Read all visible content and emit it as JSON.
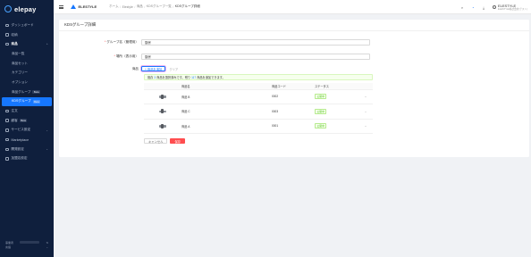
{
  "app": {
    "logo": "elepay"
  },
  "sidebar": {
    "items": [
      {
        "label": "ダッシュボード"
      },
      {
        "label": "収納"
      },
      {
        "label": "商品"
      },
      {
        "label": "商品一覧"
      },
      {
        "label": "商品セット"
      },
      {
        "label": "カテゴリー"
      },
      {
        "label": "オプション"
      },
      {
        "label": "商品グループ",
        "badge": "Beta"
      },
      {
        "label": "KDSグループ",
        "badge": "Beta"
      },
      {
        "label": "注文"
      },
      {
        "label": "顧客",
        "badge": "Beta"
      },
      {
        "label": "サービス設定"
      },
      {
        "label": "Marketplace"
      },
      {
        "label": "開発設定"
      },
      {
        "label": "加盟店設定"
      }
    ],
    "footer": {
      "line1": "事業者",
      "line2": "言語"
    }
  },
  "header": {
    "shop_name": "ELESTYLE",
    "breadcrumbs": [
      "ホーム",
      "Elestyle",
      "商品",
      "KDSグループ一覧",
      "KDSグループ詳細"
    ],
    "user_name": "ELESTYLE",
    "user_sub": "ELESTYLE株式会社(テスト)"
  },
  "page": {
    "title": "KDSグループ詳細",
    "form": {
      "group_name_label": "グループ名（管理用）",
      "group_name_value": "厨房",
      "kitchen_name_label": "場所（表示用）",
      "kitchen_name_value": "厨房",
      "products_label": "商品",
      "add_button": "+ 商品を追加",
      "clear_button": "クリア",
      "alert_prefix": "既存",
      "alert_count_selected": "3",
      "alert_mid": "商品を選択済みです。残り",
      "alert_count_remaining": "117",
      "alert_suffix": "商品を追加できます。"
    },
    "table": {
      "headers": [
        "",
        "商品名",
        "商品コード",
        "ステータス",
        ""
      ],
      "rows": [
        {
          "name": "商品 B",
          "code": "0002",
          "status": "公開中"
        },
        {
          "name": "商品 C",
          "code": "0003",
          "status": "公開中"
        },
        {
          "name": "商品 A",
          "code": "0001",
          "status": "公開中"
        }
      ]
    },
    "buttons": {
      "cancel": "キャンセル",
      "save": "保存"
    }
  },
  "colors": {
    "sidebar_bg": "#0f1f3d",
    "primary": "#1677ff",
    "danger": "#ff4d4f",
    "success": "#52c41a"
  }
}
